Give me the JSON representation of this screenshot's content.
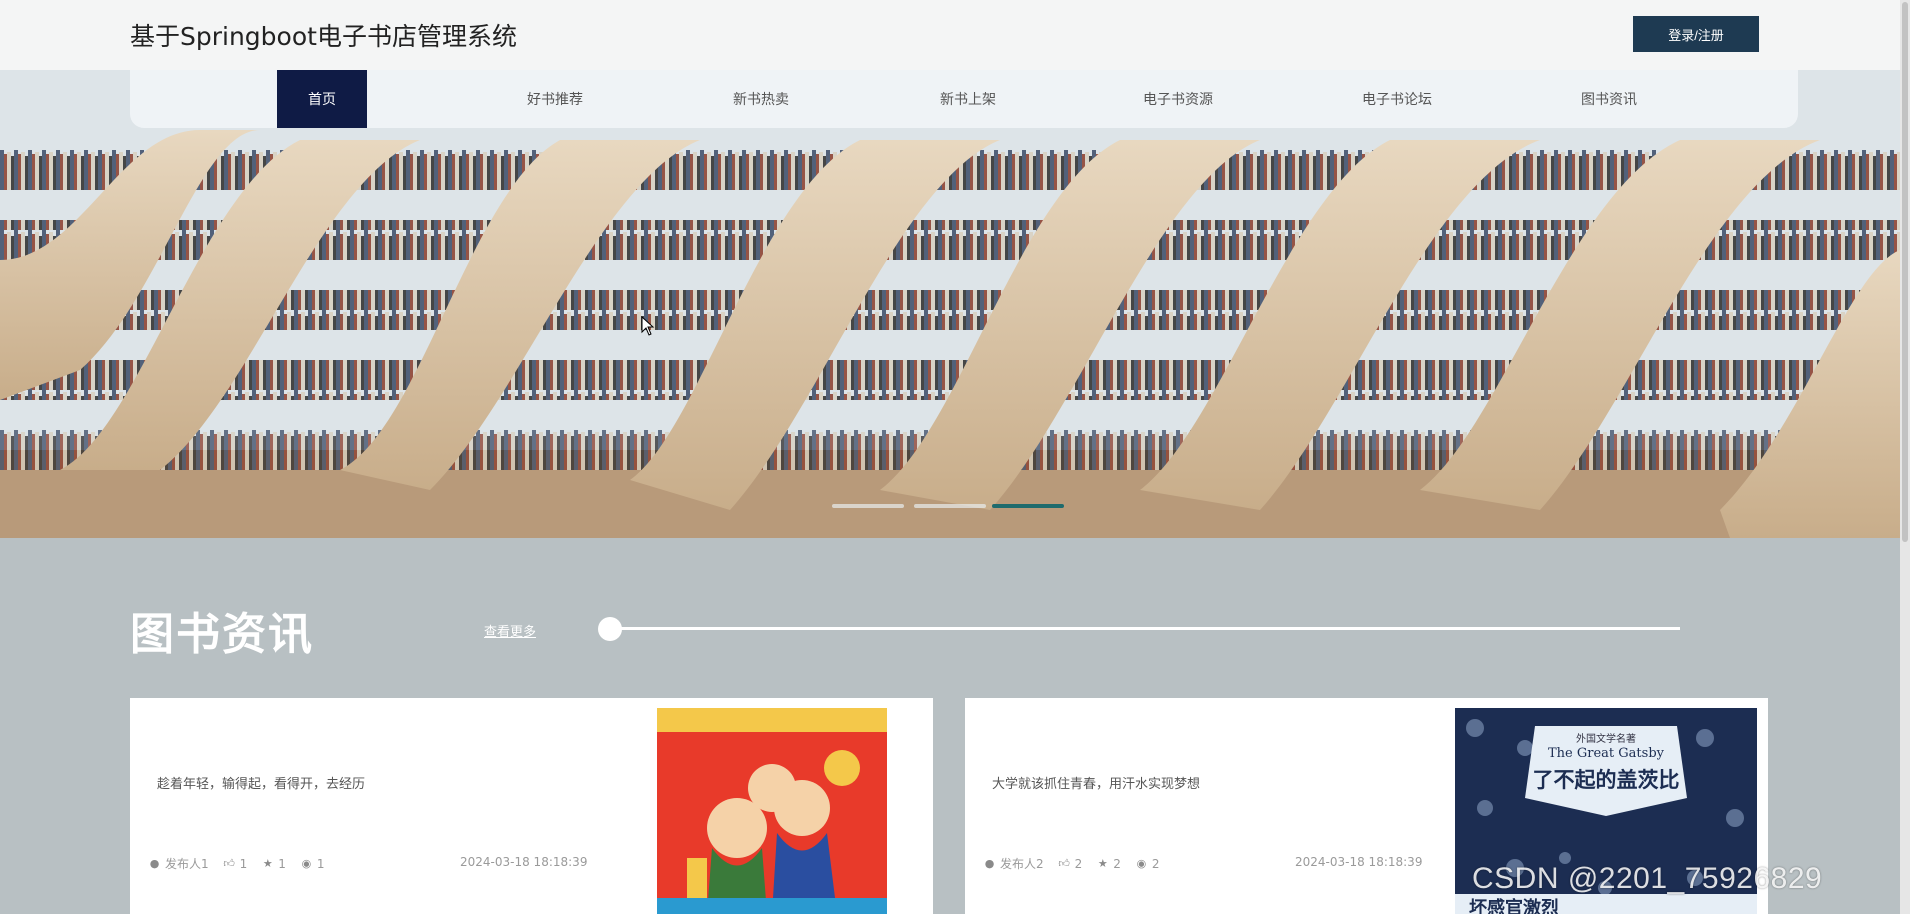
{
  "header": {
    "title": "基于Springboot电子书店管理系统",
    "login_label": "登录/注册"
  },
  "nav": {
    "items": [
      {
        "label": "首页",
        "active": true
      },
      {
        "label": "好书推荐",
        "active": false
      },
      {
        "label": "新书热卖",
        "active": false
      },
      {
        "label": "新书上架",
        "active": false
      },
      {
        "label": "电子书资源",
        "active": false
      },
      {
        "label": "电子书论坛",
        "active": false
      },
      {
        "label": "图书资讯",
        "active": false
      }
    ]
  },
  "carousel": {
    "slide_count": 3,
    "active_index": 2,
    "colors": {
      "active": "#1e6b6d",
      "inactive": "#e8ecee"
    }
  },
  "news": {
    "title": "图书资讯",
    "more_label": "查看更多",
    "items": [
      {
        "desc": "趁着年轻，输得起，看得开，去经历",
        "publisher": "发布人1",
        "likes": "1",
        "favorites": "1",
        "views": "1",
        "date": "2024-03-18 18:18:39",
        "image": "poster-fortune-gods"
      },
      {
        "desc": "大学就该抓住青春，用汗水实现梦想",
        "publisher": "发布人2",
        "likes": "2",
        "favorites": "2",
        "views": "2",
        "date": "2024-03-18 18:18:39",
        "image": "book-cover-great-gatsby",
        "cover": {
          "top_text": "外国文学名著",
          "en_title": "The Great Gatsby",
          "cn_title": "了不起的盖茨比",
          "bottom_text": "坏感官激烈"
        }
      }
    ]
  },
  "watermark": "CSDN @2201_75926829",
  "colors": {
    "header_bg": "#f4f5f5",
    "login_bg": "#1e3a52",
    "nav_active_bg": "#0f1b45",
    "section_bg": "#b8c0c3"
  }
}
